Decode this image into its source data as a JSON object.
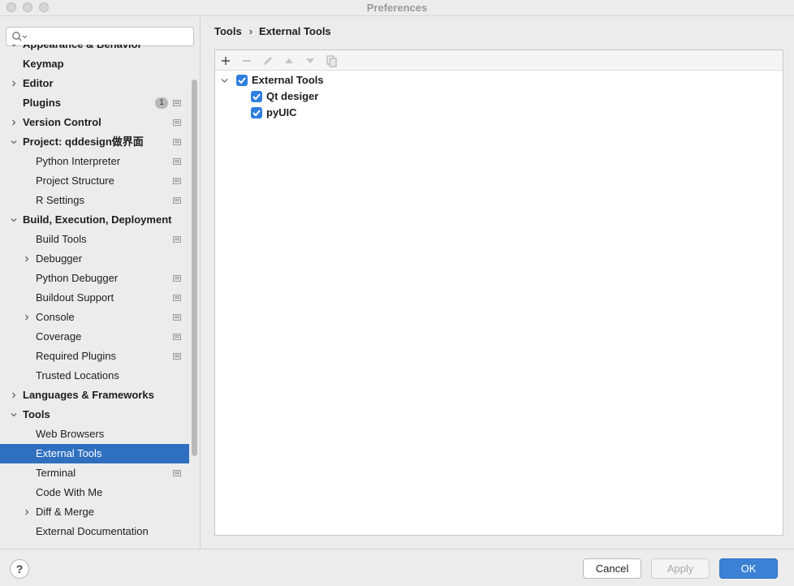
{
  "window": {
    "title": "Preferences"
  },
  "search": {
    "placeholder": "",
    "value": ""
  },
  "sidebar": {
    "items": [
      {
        "label": "Appearance & Behavior",
        "level": 0,
        "bold": true,
        "arrow": "down",
        "partial": true
      },
      {
        "label": "Keymap",
        "level": 0,
        "bold": true
      },
      {
        "label": "Editor",
        "level": 0,
        "bold": true,
        "arrow": "right"
      },
      {
        "label": "Plugins",
        "level": 0,
        "bold": true,
        "badge": "1",
        "proj": true
      },
      {
        "label": "Version Control",
        "level": 0,
        "bold": true,
        "arrow": "right",
        "proj": true
      },
      {
        "label": "Project: qddesign做界面",
        "level": 0,
        "bold": true,
        "arrow": "down",
        "proj": true
      },
      {
        "label": "Python Interpreter",
        "level": 1,
        "proj": true
      },
      {
        "label": "Project Structure",
        "level": 1,
        "proj": true
      },
      {
        "label": "R Settings",
        "level": 1,
        "proj": true
      },
      {
        "label": "Build, Execution, Deployment",
        "level": 0,
        "bold": true,
        "arrow": "down"
      },
      {
        "label": "Build Tools",
        "level": 1,
        "proj": true
      },
      {
        "label": "Debugger",
        "level": 1,
        "arrow": "right"
      },
      {
        "label": "Python Debugger",
        "level": 1,
        "proj": true
      },
      {
        "label": "Buildout Support",
        "level": 1,
        "proj": true
      },
      {
        "label": "Console",
        "level": 1,
        "arrow": "right",
        "proj": true
      },
      {
        "label": "Coverage",
        "level": 1,
        "proj": true
      },
      {
        "label": "Required Plugins",
        "level": 1,
        "proj": true
      },
      {
        "label": "Trusted Locations",
        "level": 1
      },
      {
        "label": "Languages & Frameworks",
        "level": 0,
        "bold": true,
        "arrow": "right"
      },
      {
        "label": "Tools",
        "level": 0,
        "bold": true,
        "arrow": "down"
      },
      {
        "label": "Web Browsers",
        "level": 1
      },
      {
        "label": "External Tools",
        "level": 1,
        "selected": true
      },
      {
        "label": "Terminal",
        "level": 1,
        "proj": true
      },
      {
        "label": "Code With Me",
        "level": 1
      },
      {
        "label": "Diff & Merge",
        "level": 1,
        "arrow": "right"
      },
      {
        "label": "External Documentation",
        "level": 1
      }
    ]
  },
  "main": {
    "breadcrumb": [
      "Tools",
      "External Tools"
    ],
    "toolbar": [
      "add-icon",
      "remove-icon",
      "edit-icon",
      "move-up-icon",
      "move-down-icon",
      "copy-icon"
    ],
    "tree": [
      {
        "label": "External Tools",
        "checked": true,
        "level": 0,
        "expanded": true
      },
      {
        "label": "Qt desiger",
        "checked": true,
        "level": 1
      },
      {
        "label": "pyUIC",
        "checked": true,
        "level": 1
      }
    ]
  },
  "footer": {
    "help_label": "?",
    "cancel_label": "Cancel",
    "apply_label": "Apply",
    "ok_label": "OK"
  },
  "colors": {
    "selection": "#2f6fbf",
    "accent": "#3b82d6",
    "checkbox": "#2f7ee0"
  }
}
